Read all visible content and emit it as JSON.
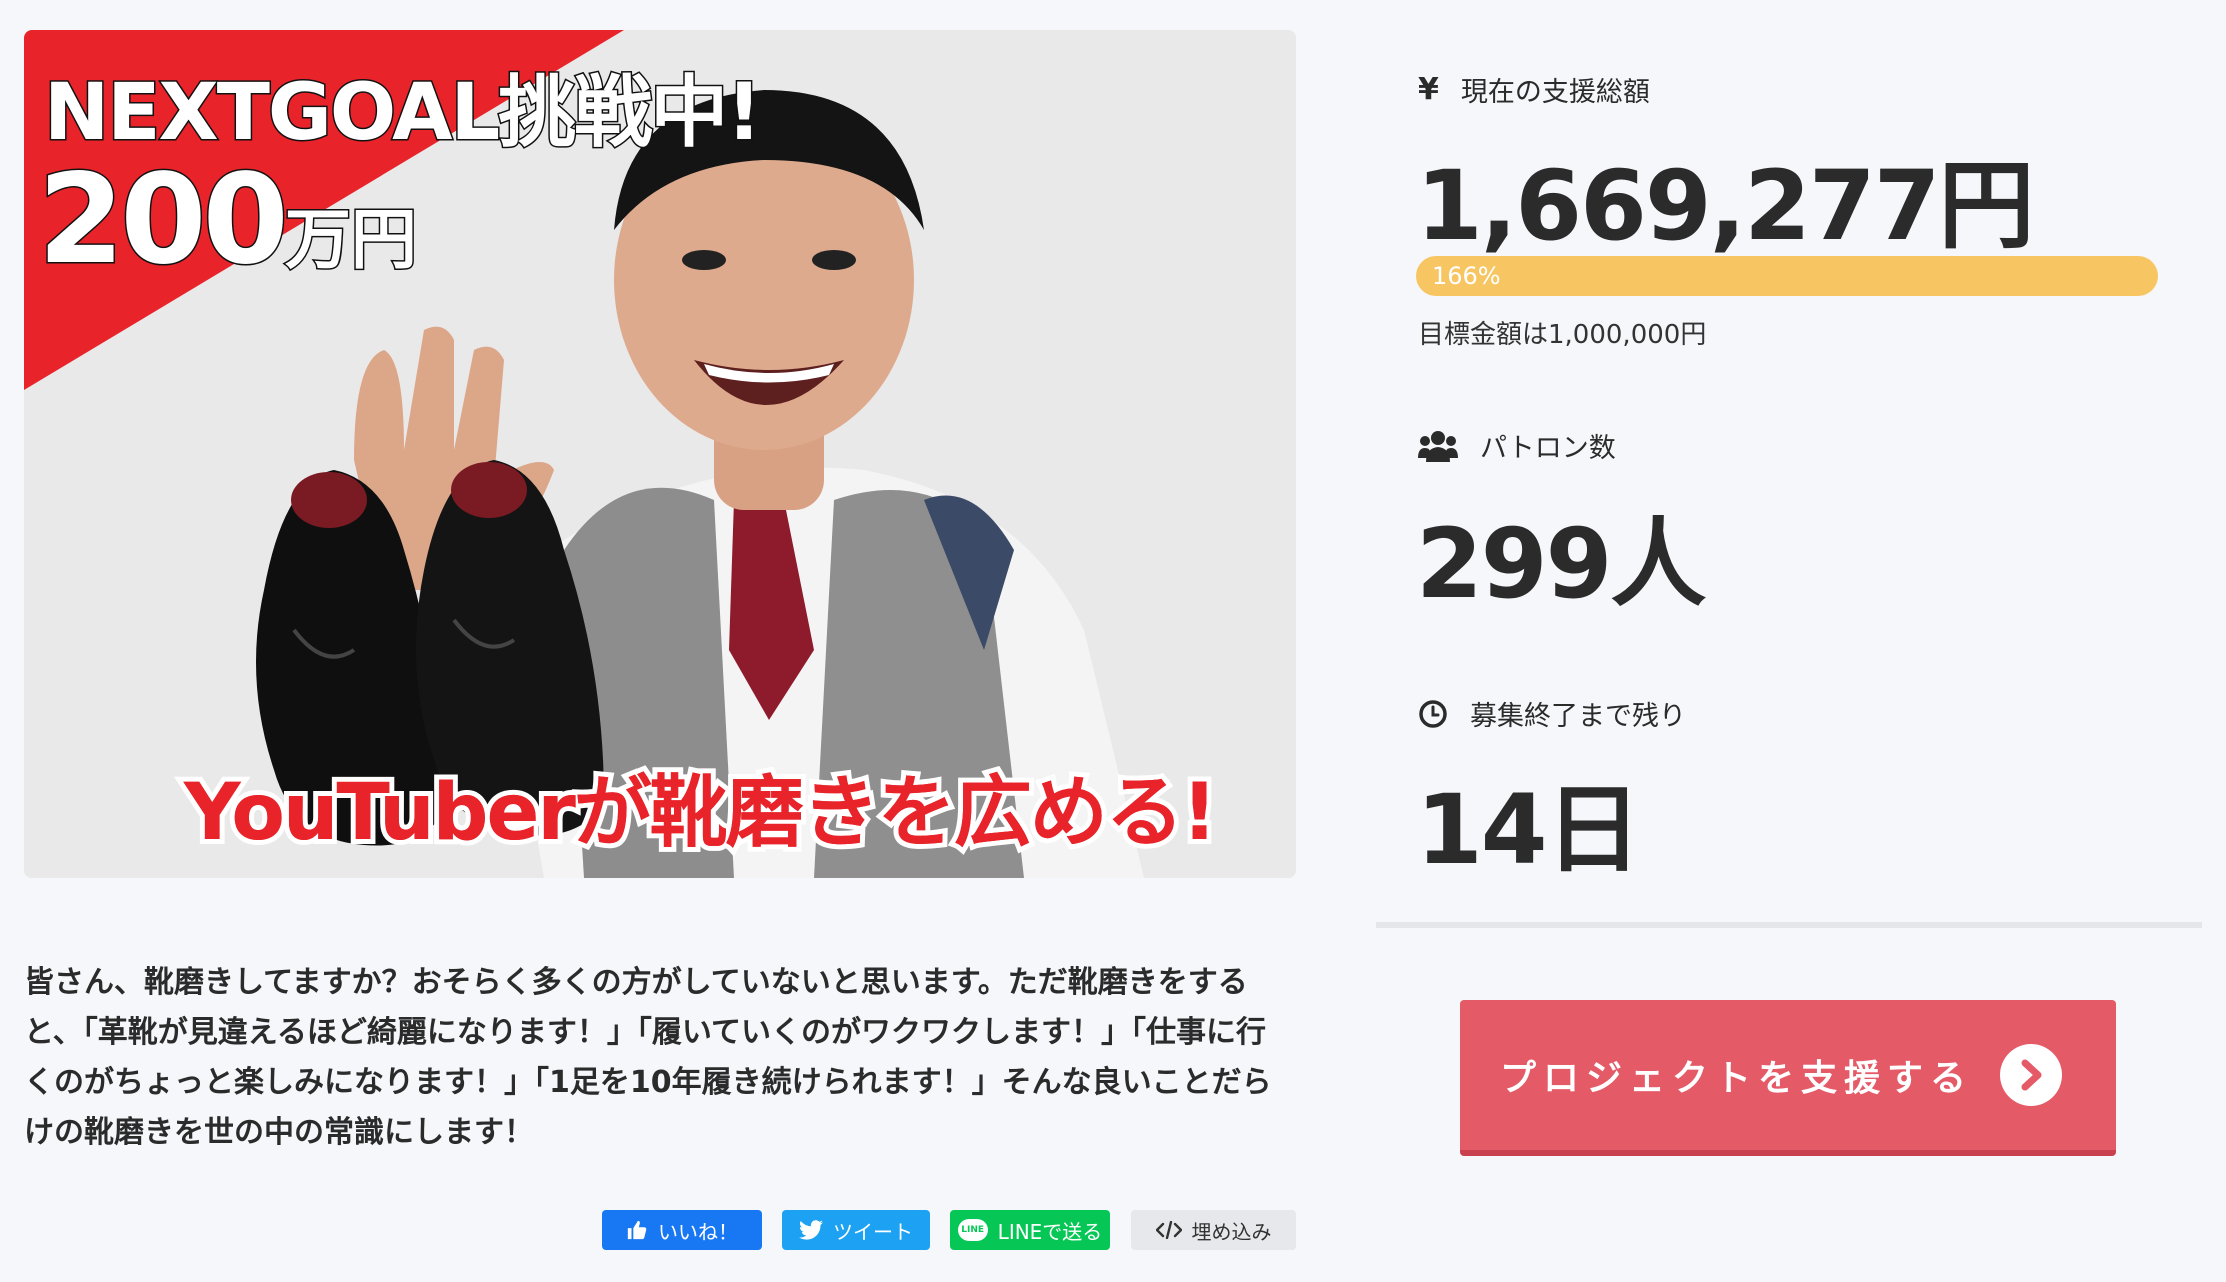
{
  "hero": {
    "headline": "NEXTGOAL挑戦中!",
    "amount": "200",
    "amount_unit": "万円",
    "caption": "YouTuberが靴磨きを広める!"
  },
  "description": "皆さん、靴磨きしてますか？おそらく多くの方がしていないと思います。ただ靴磨きをすると、「革靴が見違えるほど綺麗になります！」「履いていくのがワクワクします！」「仕事に行くのがちょっと楽しみになります！」「1足を10年履き続けられます！」そんな良いことだらけの靴磨きを世の中の常識にします！",
  "share": {
    "like": "いいね！",
    "tweet": "ツイート",
    "line_icon": "LINE",
    "line": "LINEで送る",
    "embed": "埋め込み"
  },
  "stats": {
    "total_icon": "¥",
    "total_label": "現在の支援総額",
    "total_value": "1,669,277円",
    "progress_percent": 166,
    "progress_text": "166%",
    "goal_text": "目標金額は1,000,000円",
    "patron_label": "パトロン数",
    "patron_value": "299人",
    "remaining_label": "募集終了まで残り",
    "remaining_value": "14日"
  },
  "support_button": "プロジェクトを支援する",
  "colors": {
    "accent": "#e55a67",
    "progress": "#f7c663",
    "facebook": "#1877f2",
    "twitter": "#1da1f2",
    "line": "#06c755"
  }
}
